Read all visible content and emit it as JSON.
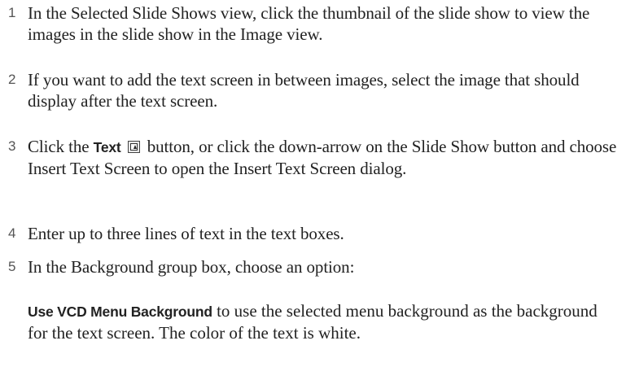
{
  "steps": [
    {
      "number": "1",
      "text": "In the Selected Slide Shows view, click the thumbnail of the slide show to view the images in the slide show in the Image view."
    },
    {
      "number": "2",
      "text": "If you want to add the text screen in between images, select the image that should display after the text screen."
    },
    {
      "number": "3",
      "prefix": "Click the ",
      "bold": "Text",
      "icon": "text-screen-button-icon",
      "suffix": " button, or click the down-arrow on the Slide Show button and choose Insert Text Screen to open the Insert Text Screen dialog."
    },
    {
      "number": "4",
      "text": "Enter up to three lines of text in the text boxes."
    },
    {
      "number": "5",
      "text": "In the Background group box, choose an option:"
    }
  ],
  "option": {
    "bold": "Use VCD Menu Background",
    "text": " to use the selected menu background as the background for the text screen. The color of the text is white."
  }
}
